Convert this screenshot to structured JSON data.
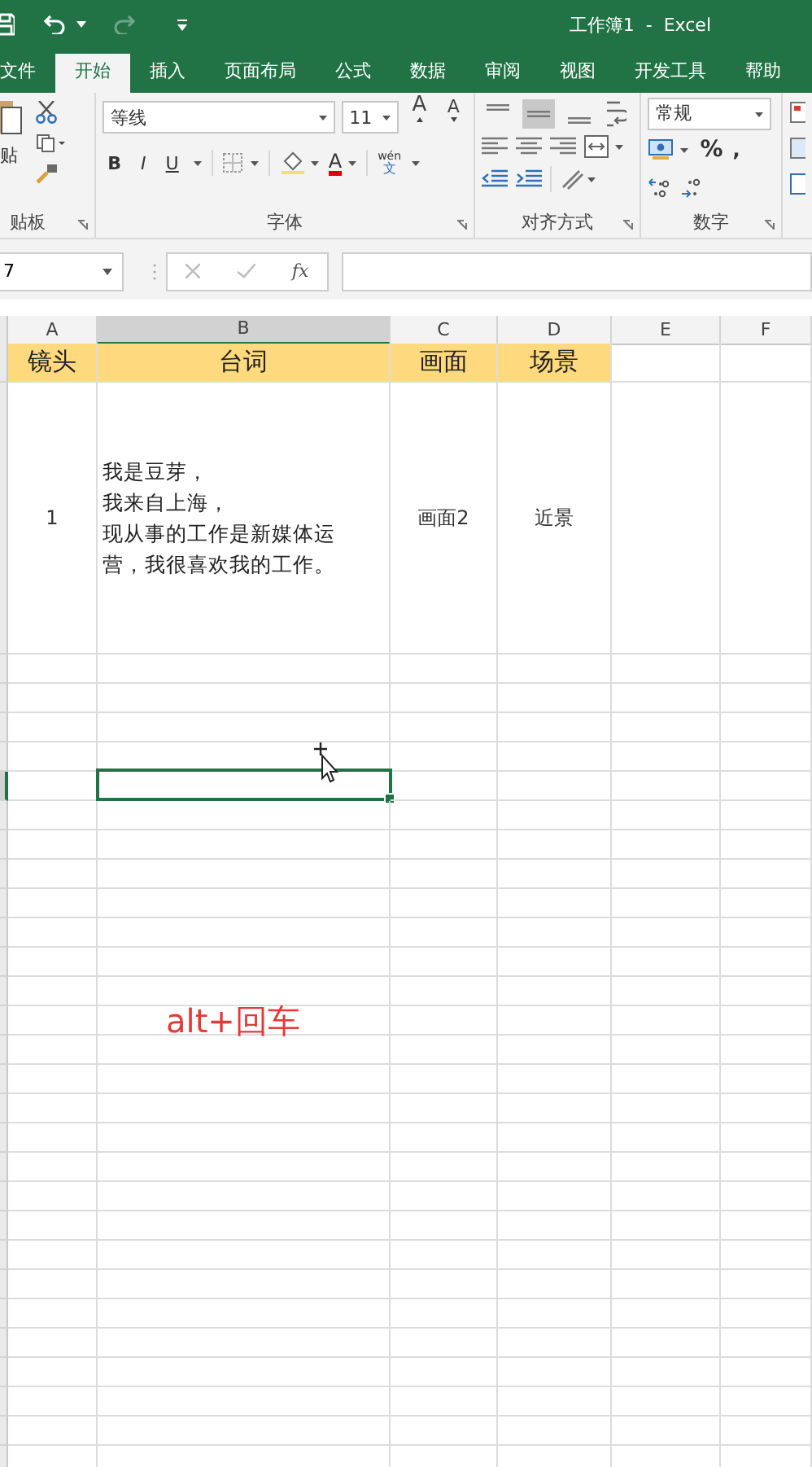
{
  "title_bar": {
    "title": "工作簿1  -  Excel",
    "redo_disabled": true
  },
  "tabs": [
    {
      "label": "文件",
      "selected": false
    },
    {
      "label": "开始",
      "selected": true
    },
    {
      "label": "插入",
      "selected": false
    },
    {
      "label": "页面布局",
      "selected": false
    },
    {
      "label": "公式",
      "selected": false
    },
    {
      "label": "数据",
      "selected": false
    },
    {
      "label": "审阅",
      "selected": false
    },
    {
      "label": "视图",
      "selected": false
    },
    {
      "label": "开发工具",
      "selected": false
    },
    {
      "label": "帮助",
      "selected": false
    }
  ],
  "ribbon": {
    "clipboard": {
      "paste_label": "贴",
      "group_label": "贴板"
    },
    "font": {
      "font_name": "等线",
      "font_size": "11",
      "grow_label": "A",
      "shrink_label": "A",
      "style_buttons": [
        "B",
        "I",
        "U"
      ],
      "font_color_label": "A",
      "phonetic_top": "wén",
      "phonetic_bottom": "文",
      "group_label": "字体"
    },
    "alignment": {
      "vertical_buttons": [
        {
          "kind": "top",
          "selected": false
        },
        {
          "kind": "middle",
          "selected": true
        },
        {
          "kind": "bottom",
          "selected": false
        }
      ],
      "group_label": "对齐方式"
    },
    "number": {
      "format": "常规",
      "percent": "%",
      "comma": ",",
      "group_label": "数字"
    }
  },
  "formula_bar": {
    "name_box": "7",
    "fx": "fx"
  },
  "sheet": {
    "columns": [
      {
        "label": "A",
        "selected": false
      },
      {
        "label": "B",
        "selected": true
      },
      {
        "label": "C",
        "selected": false
      },
      {
        "label": "D",
        "selected": false
      },
      {
        "label": "E",
        "selected": false
      },
      {
        "label": "F",
        "selected": false
      }
    ],
    "header_row": [
      "镜头",
      "台词",
      "画面",
      "场景"
    ],
    "data_row": [
      {
        "kind": "text",
        "text": "1"
      },
      {
        "kind": "lines",
        "lines": [
          "我是豆芽，",
          "我来自上海，",
          "现从事的工作是新媒体运",
          "营，我很喜欢我的工作。"
        ]
      },
      {
        "kind": "text",
        "text": "画面2"
      },
      {
        "kind": "text",
        "text": "近景"
      }
    ],
    "empty_rows": [
      {
        "selected": false
      },
      {
        "selected": false
      },
      {
        "selected": false
      },
      {
        "selected": false
      },
      {
        "selected": true
      },
      {
        "selected": false
      },
      {
        "selected": false
      },
      {
        "selected": false
      },
      {
        "selected": false
      },
      {
        "selected": false
      },
      {
        "selected": false
      },
      {
        "selected": false
      },
      {
        "selected": false
      },
      {
        "selected": false
      },
      {
        "selected": false
      },
      {
        "selected": false
      },
      {
        "selected": false
      },
      {
        "selected": false
      },
      {
        "selected": false
      },
      {
        "selected": false
      },
      {
        "selected": false
      },
      {
        "selected": false
      },
      {
        "selected": false
      },
      {
        "selected": false
      },
      {
        "selected": false
      },
      {
        "selected": false
      },
      {
        "selected": false
      },
      {
        "selected": false
      }
    ]
  },
  "annotation": "alt+回车"
}
